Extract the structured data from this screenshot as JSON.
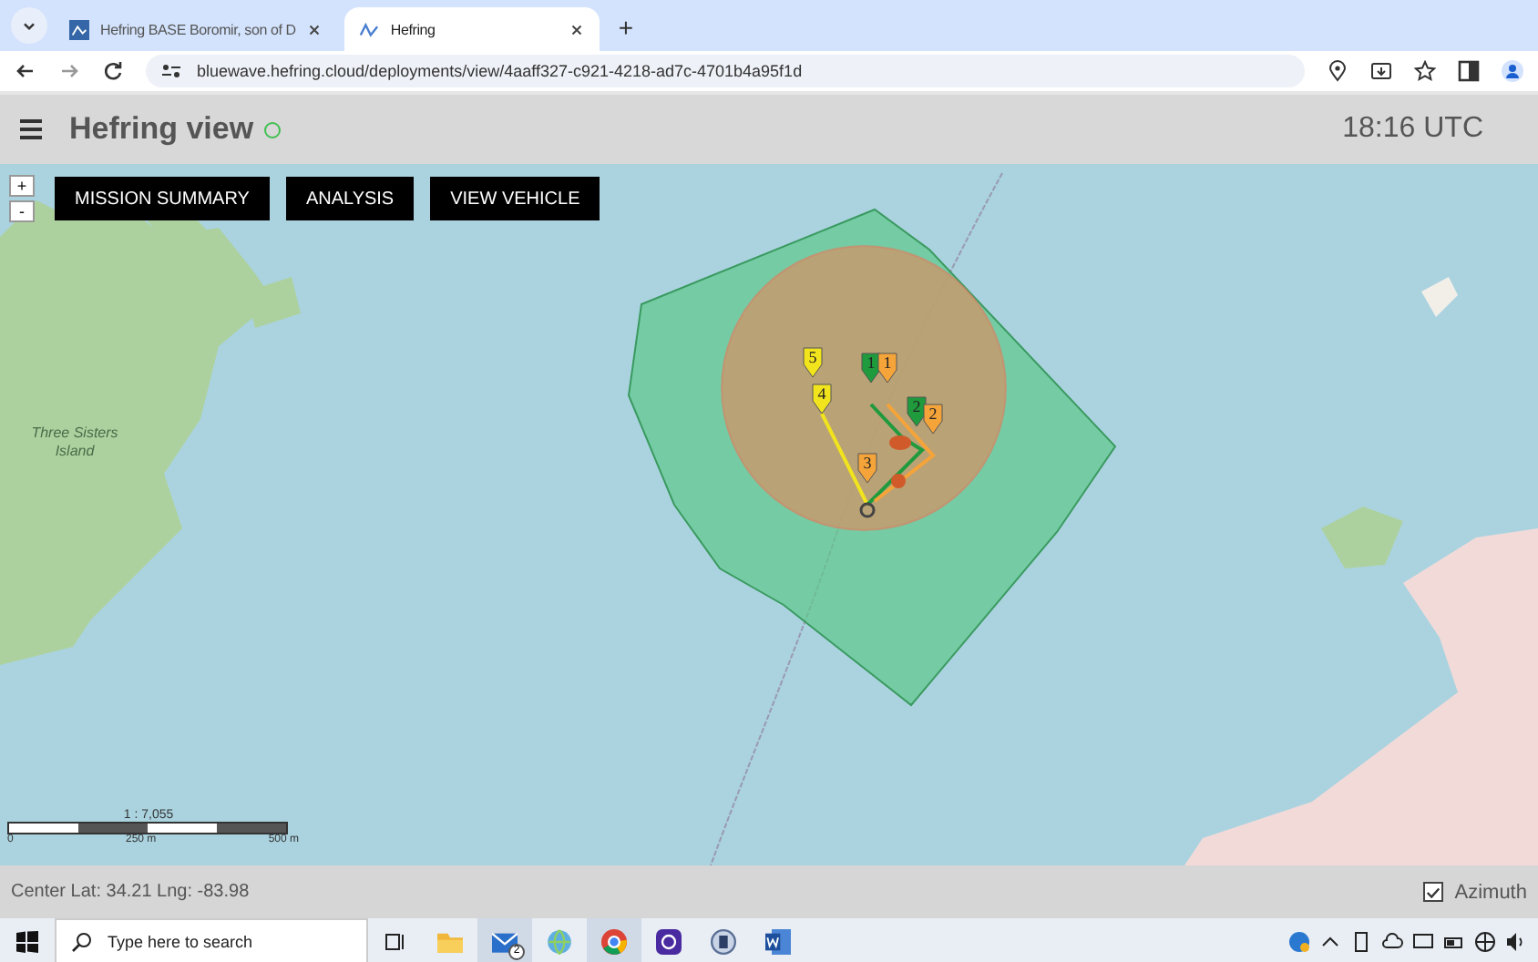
{
  "browser": {
    "tabs": [
      {
        "title": "Hefring BASE Boromir, son of D",
        "selected": false
      },
      {
        "title": "Hefring",
        "selected": true
      }
    ],
    "new_tab": "+",
    "url": "bluewave.hefring.cloud/deployments/view/4aaff327-c921-4218-ad7c-4701b4a95f1d"
  },
  "header": {
    "title": "Hefring view",
    "time": "18:16 UTC"
  },
  "map": {
    "zoom_buttons": [
      "+",
      "-"
    ],
    "buttons": [
      "MISSION SUMMARY",
      "ANALYSIS",
      "VIEW VEHICLE"
    ],
    "place_label": "Three Sisters Island",
    "scale": {
      "ratio": "1 : 7,055",
      "ticks": [
        "0",
        "250 m",
        "500 m"
      ]
    },
    "markers": [
      {
        "label": "5",
        "color": "#f2e41c"
      },
      {
        "label": "4",
        "color": "#f2e41c"
      },
      {
        "label": "1",
        "color": "#1f9a3c"
      },
      {
        "label": "1",
        "color": "#f5a43a"
      },
      {
        "label": "2",
        "color": "#1f9a3c"
      },
      {
        "label": "2",
        "color": "#f5a43a"
      },
      {
        "label": "3",
        "color": "#f5a43a"
      }
    ]
  },
  "footer": {
    "center": "Center Lat: 34.21 Lng: -83.98",
    "azimuth": {
      "label": "Azimuth",
      "checked": true
    }
  },
  "taskbar": {
    "search_placeholder": "Type here to search",
    "mail_badge": "2"
  }
}
